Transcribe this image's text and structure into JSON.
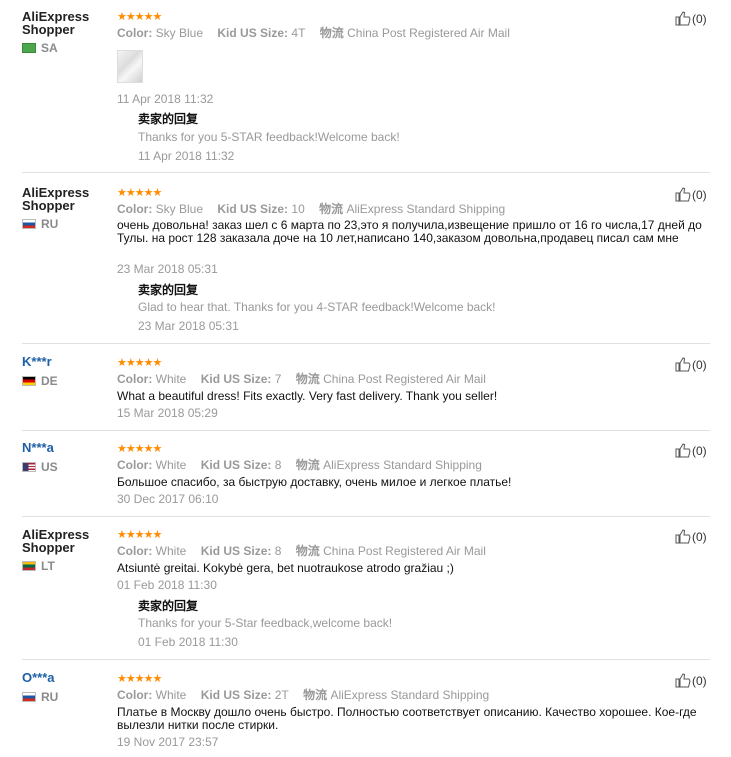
{
  "labels": {
    "color": "Color:",
    "size": "Kid US Size:",
    "shipping": "物流",
    "seller_reply": "卖家的回复"
  },
  "colors": {
    "stars": "#ff8c00",
    "masked_name": "#1e5fa8"
  },
  "reviews": [
    {
      "name": "AliExpress Shopper",
      "country": "SA",
      "color": "Sky Blue",
      "size": "4T",
      "shipping": "China Post Registered Air Mail",
      "stars": "★★★★★",
      "text": "",
      "date": "11 Apr 2018 11:32",
      "reply": "Thanks for you 5-STAR feedback!Welcome back!",
      "reply_date": "11 Apr 2018 11:32",
      "helpful": "(0)"
    },
    {
      "name": "AliExpress Shopper",
      "country": "RU",
      "color": "Sky Blue",
      "size": "10",
      "shipping": "AliExpress Standard Shipping",
      "stars": "★★★★★",
      "text": "очень довольна! заказ шел с 6 марта по 23,это я получила,извещение пришло от 16 го числа,17 дней до Тулы. на рост 128 заказала доче на 10 лет,написано 140,заказом довольна,продавец писал сам мне",
      "date": "23 Mar 2018 05:31",
      "reply": "Glad to hear that. Thanks for you 4-STAR feedback!Welcome back!",
      "reply_date": "23 Mar 2018 05:31",
      "helpful": "(0)"
    },
    {
      "name": "K***r",
      "country": "DE",
      "color": "White",
      "size": "7",
      "shipping": "China Post Registered Air Mail",
      "stars": "★★★★★",
      "text": "What a beautiful dress! Fits exactly. Very fast delivery. Thank you seller!",
      "date": "15 Mar 2018 05:29",
      "helpful": "(0)"
    },
    {
      "name": "N***a",
      "country": "US",
      "color": "White",
      "size": "8",
      "shipping": "AliExpress Standard Shipping",
      "stars": "★★★★★",
      "text": "Большое спасибо, за быструю доставку, очень милое и легкое платье!",
      "date": "30 Dec 2017 06:10",
      "helpful": "(0)"
    },
    {
      "name": "AliExpress Shopper",
      "country": "LT",
      "color": "White",
      "size": "8",
      "shipping": "China Post Registered Air Mail",
      "stars": "★★★★★",
      "text": "Atsiuntė greitai. Kokybė gera, bet nuotraukose atrodo gražiau ;)",
      "date": "01 Feb 2018 11:30",
      "reply": "Thanks for your 5-Star feedback,welcome back!",
      "reply_date": "01 Feb 2018 11:30",
      "helpful": "(0)"
    },
    {
      "name": "O***a",
      "country": "RU",
      "color": "White",
      "size": "2T",
      "shipping": "AliExpress Standard Shipping",
      "stars": "★★★★★",
      "text": "Платье в Москву дошло очень быстро. Полностью соответствует описанию. Качество хорошее. Кое-где вылезли нитки после стирки.",
      "date": "19 Nov 2017 23:57",
      "helpful": "(0)"
    }
  ]
}
